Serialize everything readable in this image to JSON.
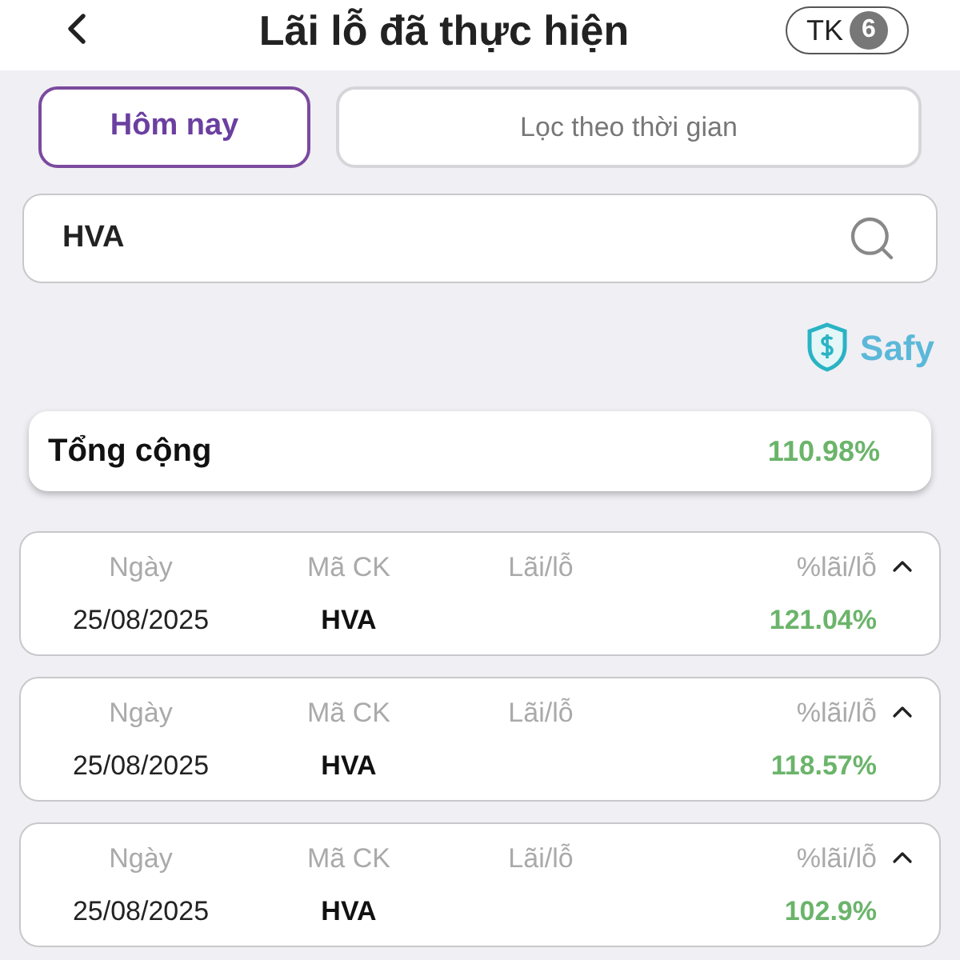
{
  "header": {
    "title": "Lãi lỗ đã thực hiện",
    "account_label": "TK",
    "account_count": "6"
  },
  "tabs": [
    {
      "label": "Hôm nay",
      "selected": true
    },
    {
      "label": "Lọc theo thời gian",
      "selected": false
    }
  ],
  "search": {
    "value": "HVA"
  },
  "brand": {
    "name": "Safy"
  },
  "total": {
    "label": "Tổng cộng",
    "value": "110.98%"
  },
  "rows": [
    {
      "columns": [
        "Ngày",
        "Mã CK",
        "Lãi/lỗ",
        "%lãi/lỗ"
      ],
      "date": "25/08/2025",
      "code": "HVA",
      "percent": "121.04%",
      "expanded": true
    },
    {
      "columns": [
        "Ngày",
        "Mã CK",
        "Lãi/lỗ",
        "%lãi/lỗ"
      ],
      "date": "25/08/2025",
      "code": "HVA",
      "percent": "118.57%",
      "expanded": true
    },
    {
      "columns": [
        "Ngày",
        "Mã CK",
        "Lãi/lỗ",
        "%lãi/lỗ"
      ],
      "date": "25/08/2025",
      "code": "HVA",
      "percent": "102.9%",
      "expanded": true
    }
  ]
}
